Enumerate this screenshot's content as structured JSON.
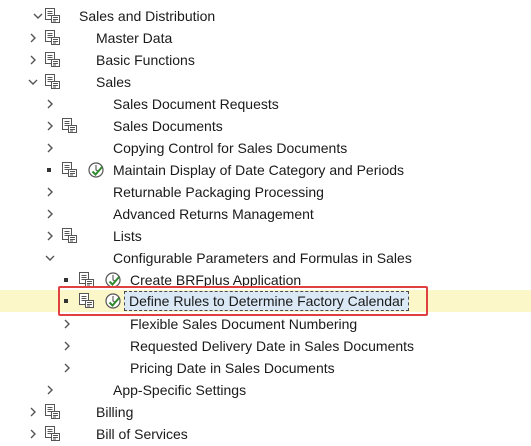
{
  "tree": {
    "items": [
      {
        "label": "Sales and Distribution"
      },
      {
        "label": "Master Data"
      },
      {
        "label": "Basic Functions"
      },
      {
        "label": "Sales"
      },
      {
        "label": "Sales Document Requests"
      },
      {
        "label": "Sales Documents"
      },
      {
        "label": "Copying Control for Sales Documents"
      },
      {
        "label": "Maintain Display of Date Category and Periods"
      },
      {
        "label": "Returnable Packaging Processing"
      },
      {
        "label": "Advanced Returns Management"
      },
      {
        "label": "Lists"
      },
      {
        "label": "Configurable Parameters and Formulas in Sales"
      },
      {
        "label": "Create BRFplus Application"
      },
      {
        "label": "Define Rules to Determine Factory Calendar"
      },
      {
        "label": "Flexible Sales Document Numbering"
      },
      {
        "label": "Requested Delivery Date in Sales Documents"
      },
      {
        "label": "Pricing Date in Sales Documents"
      },
      {
        "label": "App-Specific Settings"
      },
      {
        "label": "Billing"
      },
      {
        "label": "Bill of Services"
      }
    ],
    "selected_item": "Define Rules to Determine Factory Calendar"
  },
  "icons": {
    "document": "document-stack-icon",
    "execute": "execute-clock-check-icon",
    "expand": "chevron-right-icon",
    "collapse": "chevron-down-icon"
  },
  "colors": {
    "highlight_row": "#fbf7c9",
    "selection_bg": "#dbe9f6",
    "annotation_box": "#e04040",
    "execute_check": "#2e8b2e"
  }
}
